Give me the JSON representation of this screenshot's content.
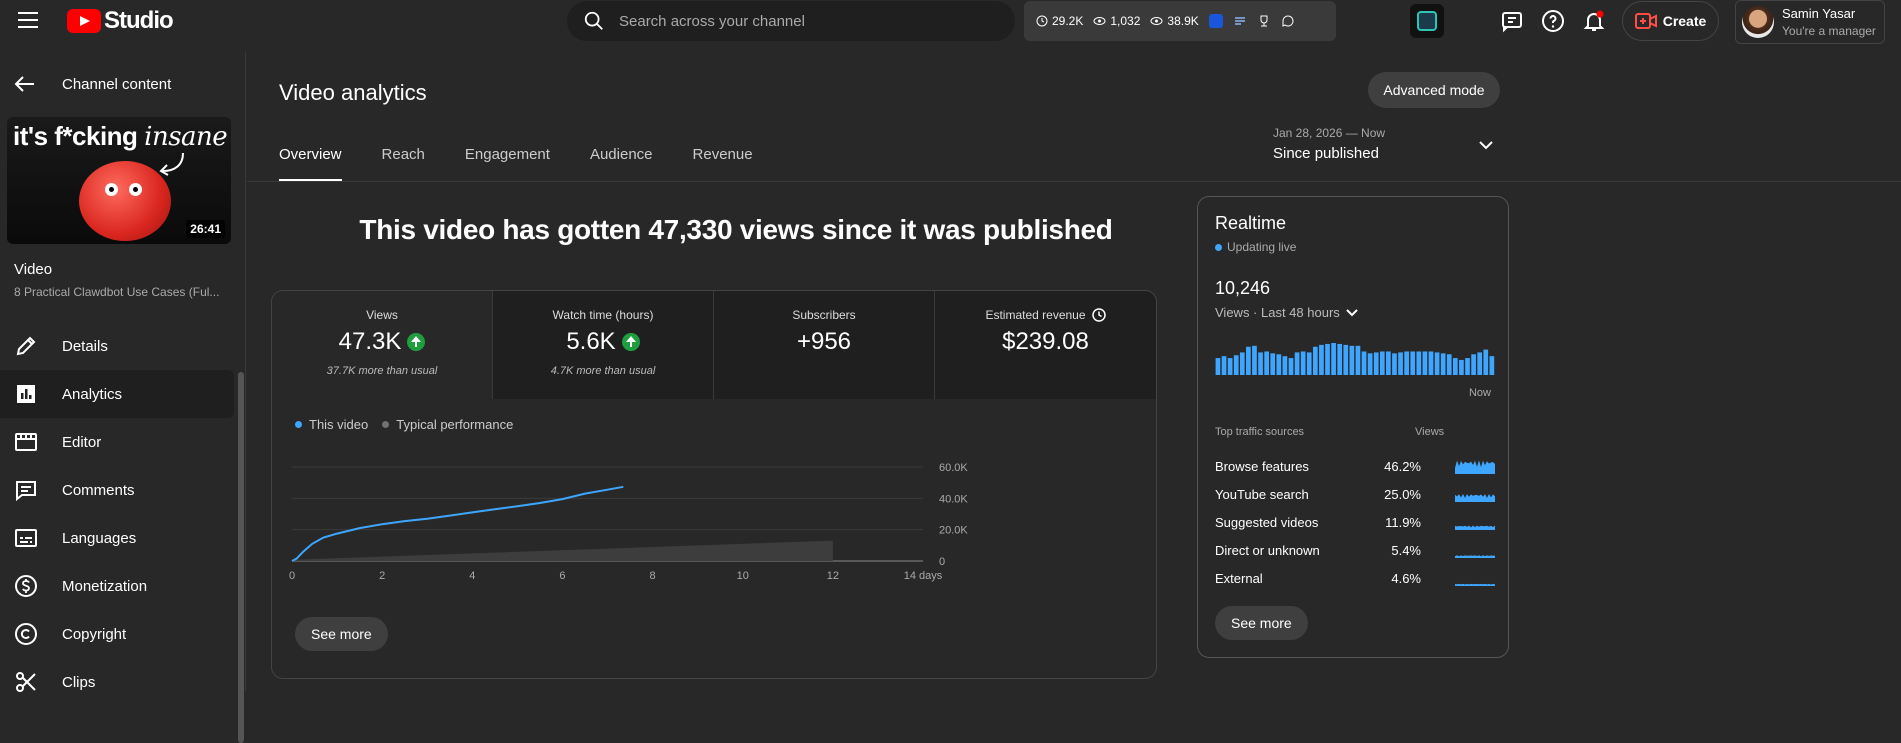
{
  "header": {
    "logo_text": "Studio",
    "search_placeholder": "Search across your channel",
    "stats": {
      "watch": "29.2K",
      "subs": "1,032",
      "views": "38.9K"
    },
    "create_label": "Create",
    "user_name": "Samin Yasar",
    "user_role": "You're a manager"
  },
  "sidebar": {
    "back_label": "Channel content",
    "thumbnail": {
      "caption_plain": "it's f*cking ",
      "caption_italic": "insane",
      "duration": "26:41"
    },
    "video_label": "Video",
    "video_title": "8 Practical Clawdbot Use Cases (Ful...",
    "items": [
      {
        "label": "Details",
        "icon": "pencil-icon"
      },
      {
        "label": "Analytics",
        "icon": "analytics-icon",
        "active": true
      },
      {
        "label": "Editor",
        "icon": "editor-icon"
      },
      {
        "label": "Comments",
        "icon": "comments-icon"
      },
      {
        "label": "Languages",
        "icon": "subtitles-icon"
      },
      {
        "label": "Monetization",
        "icon": "dollar-icon"
      },
      {
        "label": "Copyright",
        "icon": "copyright-icon"
      },
      {
        "label": "Clips",
        "icon": "scissors-icon"
      }
    ]
  },
  "main": {
    "title": "Video analytics",
    "advanced_label": "Advanced mode",
    "tabs": [
      "Overview",
      "Reach",
      "Engagement",
      "Audience",
      "Revenue"
    ],
    "date_range": "Jan 28, 2026 — Now",
    "date_label": "Since published",
    "headline": "This video has gotten 47,330 views since it was published",
    "metrics": [
      {
        "label": "Views",
        "value": "47.3K",
        "note": "37.7K more than usual",
        "up": true
      },
      {
        "label": "Watch time (hours)",
        "value": "5.6K",
        "note": "4.7K more than usual",
        "up": true
      },
      {
        "label": "Subscribers",
        "value": "+956",
        "note": "",
        "up": false
      },
      {
        "label": "Estimated revenue",
        "value": "$239.08",
        "note": "",
        "up": false
      }
    ],
    "legend": [
      "This video",
      "Typical performance"
    ],
    "see_more": "See more"
  },
  "chart_data": {
    "type": "line",
    "x_unit": "days",
    "x_ticks": [
      "0",
      "2",
      "4",
      "6",
      "8",
      "10",
      "12",
      "14 days"
    ],
    "y_ticks": [
      "0",
      "20.0K",
      "40.0K",
      "60.0K"
    ],
    "ylim": [
      0,
      60000
    ],
    "xlim": [
      0,
      14
    ],
    "series": [
      {
        "name": "This video",
        "color": "#3ea6ff",
        "x": [
          0,
          0.1,
          0.25,
          0.45,
          0.7,
          1,
          1.5,
          2,
          2.5,
          3,
          3.5,
          4,
          4.5,
          5,
          5.5,
          6,
          6.5,
          7,
          7.35
        ],
        "y": [
          0,
          1500,
          6000,
          11000,
          15000,
          17500,
          21000,
          23500,
          25500,
          27000,
          29000,
          31000,
          33000,
          35000,
          37000,
          39500,
          43000,
          45500,
          47330
        ]
      },
      {
        "name": "Typical performance",
        "color": "#555555",
        "x": [
          0,
          12
        ],
        "low": [
          0,
          0
        ],
        "high": [
          800,
          13000
        ]
      }
    ]
  },
  "realtime": {
    "title": "Realtime",
    "status": "Updating live",
    "views": "10,246",
    "period": "Views · Last 48 hours",
    "now_label": "Now",
    "bars": [
      18,
      20,
      18,
      21,
      24,
      30,
      31,
      24,
      25,
      23,
      22,
      20,
      18,
      24,
      25,
      24,
      30,
      32,
      33,
      34,
      33,
      32,
      31,
      31,
      25,
      23,
      24,
      25,
      25,
      23,
      24,
      25,
      25,
      25,
      25,
      25,
      24,
      23,
      22,
      18,
      16,
      18,
      22,
      24,
      27,
      20
    ],
    "traffic_header": [
      "Top traffic sources",
      "Views"
    ],
    "traffic": [
      {
        "name": "Browse features",
        "pct": "46.2%",
        "level": 0.9
      },
      {
        "name": "YouTube search",
        "pct": "25.0%",
        "level": 0.5
      },
      {
        "name": "Suggested videos",
        "pct": "11.9%",
        "level": 0.25
      },
      {
        "name": "Direct or unknown",
        "pct": "5.4%",
        "level": 0.12
      },
      {
        "name": "External",
        "pct": "4.6%",
        "level": 0.08
      }
    ],
    "see_more": "See more"
  }
}
